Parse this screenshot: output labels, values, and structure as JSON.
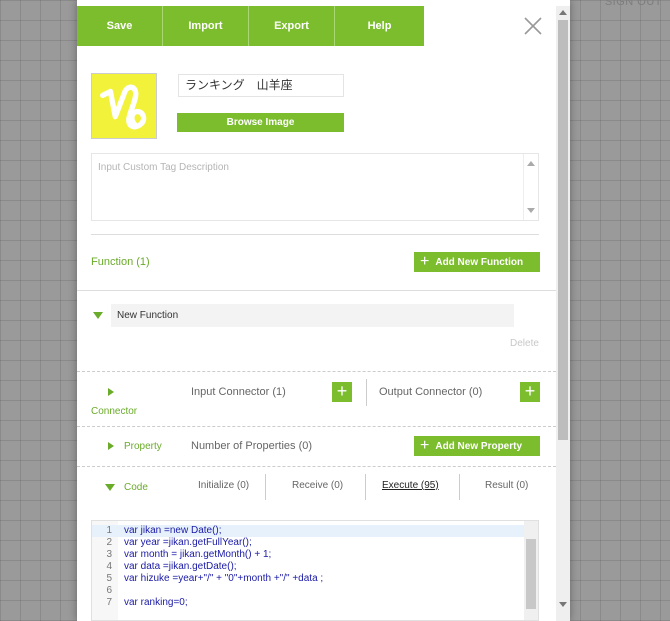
{
  "page": {
    "signout_label": "SIGN OUT"
  },
  "toolbar": {
    "buttons": [
      "Save",
      "Import",
      "Export",
      "Help"
    ]
  },
  "tag": {
    "image_icon": "capricorn-symbol-icon",
    "name_value": "ランキング　山羊座",
    "browse_label": "Browse Image",
    "description_placeholder": "Input Custom Tag Description"
  },
  "functions": {
    "title": "Function (1)",
    "add_label": "Add New Function",
    "items": [
      {
        "name": "New Function",
        "delete_label": "Delete"
      }
    ]
  },
  "connector": {
    "label": "Connector",
    "input_label": "Input Connector (1)",
    "output_label": "Output Connector (0)"
  },
  "property": {
    "label": "Property",
    "count_label": "Number of Properties (0)",
    "add_label": "Add New Property"
  },
  "code": {
    "label": "Code",
    "tabs": [
      "Initialize (0)",
      "Receive (0)",
      "Execute (95)",
      "Result (0)"
    ],
    "active_tab": "Execute (95)",
    "lines": [
      {
        "n": "1",
        "text": "var jikan =new Date();"
      },
      {
        "n": "2",
        "text": "var year =jikan.getFullYear();"
      },
      {
        "n": "3",
        "text": "var month = jikan.getMonth() + 1;"
      },
      {
        "n": "4",
        "text": "var data =jikan.getDate();"
      },
      {
        "n": "5",
        "text": "var hizuke =year+\"/\" + \"0\"+month +\"/\" +data ;"
      },
      {
        "n": "6",
        "text": ""
      },
      {
        "n": "7",
        "text": "var ranking=0;"
      }
    ]
  },
  "colors": {
    "accent": "#7bbd2c",
    "accent_text": "#6aab2a",
    "tag_image_bg": "#f2f23a"
  }
}
